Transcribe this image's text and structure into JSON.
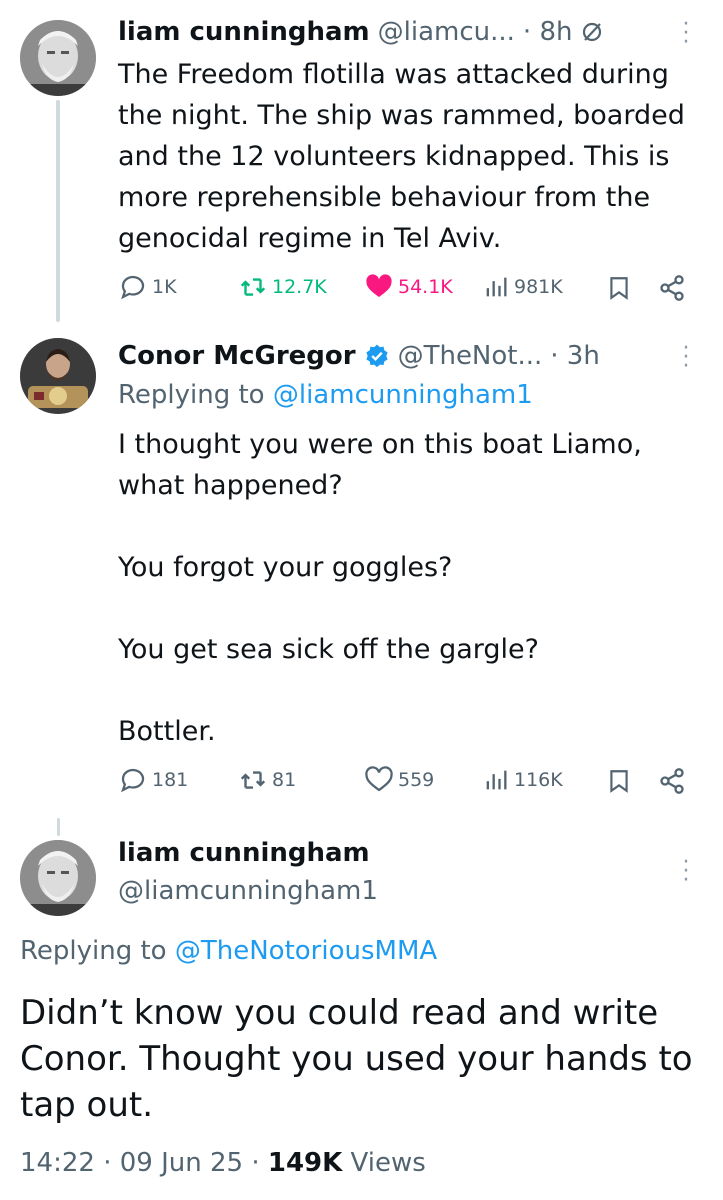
{
  "tweet1": {
    "name": "liam cunningham",
    "handle": "@liamcu...",
    "time": "· 8h",
    "text": "The Freedom flotilla was attacked during the night. The ship was rammed, boarded and the 12 volunteers kidnapped. This is more reprehensible behaviour from the genocidal regime in Tel Aviv.",
    "stats": {
      "replies": "1K",
      "reposts": "12.7K",
      "likes": "54.1K",
      "views": "981K"
    },
    "liked": true
  },
  "tweet2": {
    "name": "Conor McGregor",
    "handle": "@TheNot...",
    "time": "· 3h",
    "replying_label": "Replying to ",
    "replying_handle": "@liamcunningham1",
    "text": "I thought you were on this boat Liamo,\nwhat happened?\n\nYou forgot your goggles?\n\nYou get sea sick off the gargle?\n\nBottler.",
    "stats": {
      "replies": "181",
      "reposts": "81",
      "likes": "559",
      "views": "116K"
    }
  },
  "tweet3": {
    "name": "liam cunningham",
    "handle": "@liamcunningham1",
    "replying_label": "Replying to ",
    "replying_handle": "@TheNotoriousMMA",
    "text": "Didn’t know you could read and write Conor. Thought you used your hands to tap out.",
    "time": "14:22",
    "date": "09 Jun 25",
    "views_count": "149K",
    "views_label": "Views"
  },
  "colors": {
    "accent": "#1d9bf0",
    "like": "#f91880",
    "verified": "#1d9bf0",
    "muted": "#536471"
  }
}
